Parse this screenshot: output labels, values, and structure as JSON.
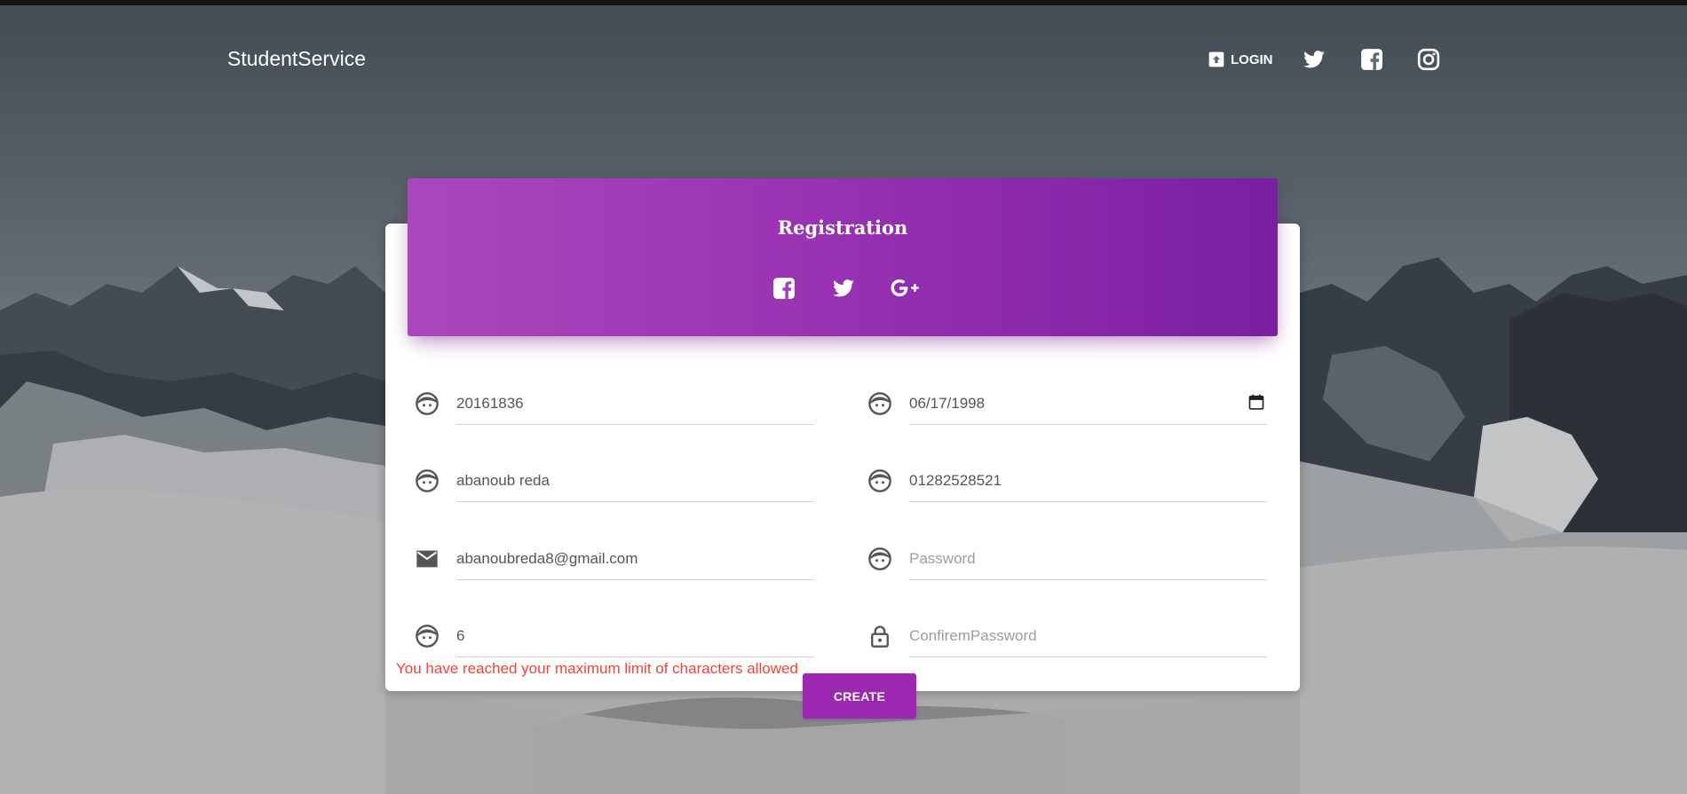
{
  "navbar": {
    "brand": "StudentService",
    "login_label": "LOGIN",
    "icons": [
      "login-icon",
      "twitter-icon",
      "facebook-icon",
      "instagram-icon"
    ]
  },
  "card": {
    "title": "Registration",
    "social_icons": [
      "facebook-icon",
      "twitter-icon",
      "google-plus-icon"
    ]
  },
  "form": {
    "student_id": {
      "value": "20161836",
      "placeholder": ""
    },
    "birth_date": {
      "value": "06/17/1998",
      "placeholder": ""
    },
    "name": {
      "value": "abanoub reda",
      "placeholder": ""
    },
    "phone": {
      "value": "01282528521",
      "placeholder": ""
    },
    "email": {
      "value": "abanoubreda8@gmail.com",
      "placeholder": ""
    },
    "password": {
      "value": "",
      "placeholder": "Password"
    },
    "level": {
      "value": "6",
      "placeholder": ""
    },
    "confirm_password": {
      "value": "",
      "placeholder": "ConfiremPassword"
    },
    "error_message": "You have reached your maximum limit of characters allowed",
    "submit_label": "CREATE"
  },
  "colors": {
    "accent": "#9c27b0",
    "header_gradient_start": "#ab47bc",
    "header_gradient_end": "#7b1fa2",
    "error": "#f44336",
    "icon": "#555555"
  }
}
